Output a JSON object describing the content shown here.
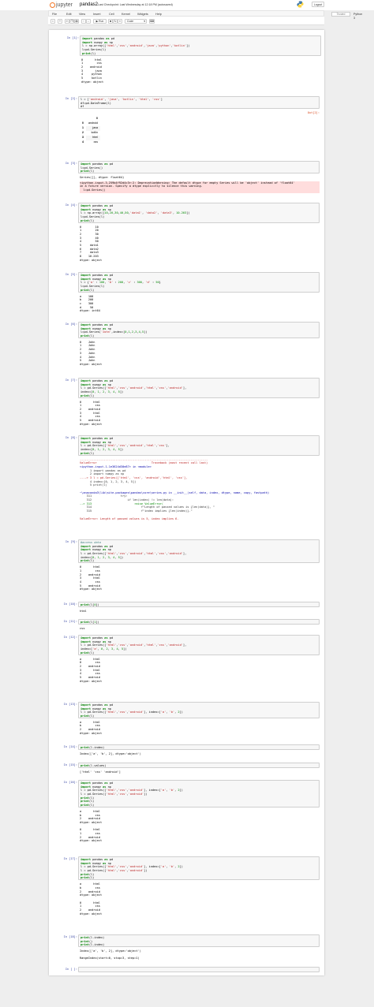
{
  "header": {
    "brand": "jupyter",
    "notebook_name": "pandas2",
    "checkpoint": "Last Checkpoint: Last Wednesday at 12:18 PM",
    "autosave": "(autosaved)",
    "logout": "Logout"
  },
  "menu": {
    "items": [
      "File",
      "Edit",
      "View",
      "Insert",
      "Cell",
      "Kernel",
      "Widgets",
      "Help"
    ],
    "trusted": "Trusted",
    "kernel": "Python 3"
  },
  "toolbar": {
    "run": "Run",
    "celltype": "Code"
  },
  "cells": [
    {
      "prompt": "In [1]:",
      "code": [
        "import pandas as pd",
        "import numpy as np",
        "l = np.array(['html','css','android','java','python','kotlin'])",
        "l=pd.Series(l)",
        "print(l)"
      ],
      "output": [
        "0       html",
        "1        css",
        "2    android",
        "3       java",
        "4     python",
        "5     kotlin",
        "dtype: object"
      ]
    },
    {
      "prompt": "In [2]:",
      "code": [
        "l = ['android', 'java', 'kotlin', 'html', 'css']",
        "df=pd.DataFrame(l)",
        "df"
      ],
      "out_prompt": "Out[2]:",
      "table": {
        "header": [
          "",
          "0"
        ],
        "rows": [
          [
            "0",
            "android"
          ],
          [
            "1",
            "java"
          ],
          [
            "2",
            "kotlin"
          ],
          [
            "3",
            "html"
          ],
          [
            "4",
            "css"
          ]
        ]
      }
    },
    {
      "prompt": "In [3]:",
      "code": [
        "import pandas as pd",
        "l=pd.Series()",
        "print(l)"
      ],
      "output": [
        "Series([], dtype: float64)"
      ],
      "stderr": [
        "<ipython-input-3-259b4f92d4c3>:2: DeprecationWarning: The default dtype for empty Series will be 'object' instead of 'float64'",
        "in a future version. Specify a dtype explicitly to silence this warning.",
        "  l=pd.Series()"
      ]
    },
    {
      "prompt": "In [4]:",
      "code": [
        "import pandas as pd",
        "import numpy as np",
        "l = np.array([10,20,30,40,50,'data1', 'data2', 'data3', 10.203])",
        "l=pd.Series(l)",
        "print(l)"
      ],
      "output": [
        "0        10",
        "1        20",
        "2        30",
        "3        40",
        "4        50",
        "5     data1",
        "6     data2",
        "7     data3",
        "8    10.203",
        "dtype: object"
      ]
    },
    {
      "prompt": "In [5]:",
      "code": [
        "import pandas as pd",
        "import numpy as np",
        "l = {'a' : 100, 'b' : 200, 'c' : 300, 'd' : 50}",
        "l=pd.Series(l)",
        "print(l)"
      ],
      "output": [
        "a    100",
        "b    200",
        "c    300",
        "d     50",
        "dtype: int64"
      ]
    },
    {
      "prompt": "In [6]:",
      "code": [
        "import pandas as pd",
        "import numpy as np",
        "l=pd.Series('John',index=[0,1,2,3,4,5])",
        "print(l)"
      ],
      "output": [
        "0    John",
        "1    John",
        "2    John",
        "3    John",
        "4    John",
        "5    John",
        "dtype: object"
      ]
    },
    {
      "prompt": "In [7]:",
      "code": [
        "import pandas as pd",
        "import numpy as np",
        "l = pd.Series(['html','css','android','html','css','android'],",
        "index=[0, 1, 2, 3, 4, 5])",
        "print(l)"
      ],
      "output": [
        "0       html",
        "1        css",
        "2    android",
        "3       html",
        "4        css",
        "5    android",
        "dtype: object"
      ]
    },
    {
      "prompt": "In [8]:",
      "code": [
        "import pandas as pd",
        "import numpy as np",
        "l = pd.Series(['html','css','android','html','css'],",
        "index=[0, 1, 2, 3, 4, 5])",
        "print(l)"
      ],
      "error": [
        "---------------------------------------------------------------------------",
        "ValueError                                Traceback (most recent call last)",
        "<ipython-input-1-1e3624d30e87> in <module>",
        "      1 import pandas as pd",
        "      2 import numpy as np",
        "----> 3 l = pd.Series(['html', 'css', 'android','html', 'css'],",
        "      4 index=[0, 1, 2, 3, 4, 5])",
        "      5 print(l)",
        "",
        "~\\anaconda3\\lib\\site-packages\\pandas\\core\\series.py in __init__(self, data, index, dtype, name, copy, fastpath)",
        "    311                 try:",
        "    312                     if len(index) != len(data):",
        "--> 313                         raise ValueError(",
        "    314                             f\"Length of passed values is {len(data)}, \"",
        "    315                             f\"index implies {len(index)}.\"",
        "",
        "ValueError: Length of passed values is 5, index implies 6."
      ]
    },
    {
      "prompt": "In [9]:",
      "code": [
        "#access data",
        "import pandas as pd",
        "import numpy as np",
        "l = pd.Series(['html','css','android','html','css','android'],",
        "index=[0, 1, 2, 3, 4, 5])",
        "print(l)"
      ],
      "output": [
        "0       html",
        "1        css",
        "2    android",
        "3       html",
        "4        css",
        "5    android",
        "dtype: object"
      ]
    },
    {
      "prompt": "In [10]:",
      "code": [
        "print(l[0])"
      ],
      "output": [
        "html"
      ]
    },
    {
      "prompt": "In [11]:",
      "code": [
        "print(l[1])"
      ],
      "output": [
        "css"
      ]
    },
    {
      "prompt": "In [12]:",
      "code": [
        "import pandas as pd",
        "import numpy as np",
        "l = pd.Series(['html','css','android','html','css','android'],",
        "index=['a', 0, 2, 3, 4, 5])",
        "print(l)"
      ],
      "output": [
        "a       html",
        "0        css",
        "2    android",
        "3       html",
        "4        css",
        "5    android",
        "dtype: object"
      ]
    },
    {
      "prompt": "In [13]:",
      "code": [
        "import pandas as pd",
        "import numpy as np",
        "l = pd.Series(['html','css','android'], index=['a', 'b', 2])",
        "print(l)"
      ],
      "output": [
        "a       html",
        "b        css",
        "2    android",
        "dtype: object"
      ]
    },
    {
      "prompt": "In [14]:",
      "code": [
        "print(l.index)"
      ],
      "output": [
        "Index(['a', 'b', 2], dtype='object')"
      ]
    },
    {
      "prompt": "In [15]:",
      "code": [
        "print(l.values)"
      ],
      "output": [
        "['html' 'css' 'android']"
      ]
    },
    {
      "prompt": "In [16]:",
      "code": [
        "import pandas as pd",
        "import numpy as np",
        "l = pd.Series(['html','css','android'], index=['a', 'b', 2])",
        "l = pd.Series(['html','css','android'])",
        "print(l)",
        "print(l)",
        "print(l)"
      ],
      "output": [
        "a       html",
        "b        css",
        "2    android",
        "dtype: object",
        "",
        "0       html",
        "1        css",
        "2    android",
        "dtype: object"
      ]
    },
    {
      "prompt": "In [17]:",
      "code": [
        "import pandas as pd",
        "import numpy as np",
        "l = pd.Series(['html','css','android'], index=['a', 'b', 2])",
        "l = pd.Series(['html','css','android'])",
        "print(l)",
        "print(l)"
      ],
      "output": [
        "a       html",
        "b        css",
        "2    android",
        "dtype: object",
        "",
        "0       html",
        "1        css",
        "2    android",
        "dtype: object"
      ]
    },
    {
      "prompt": "In [18]:",
      "code": [
        "print(l.index)",
        "print()",
        "print(l.index)"
      ],
      "output": [
        "Index(['a', 'b', 2], dtype='object')",
        "",
        "RangeIndex(start=0, stop=3, step=1)"
      ]
    },
    {
      "prompt": "In [ ]:",
      "code": [
        ""
      ]
    }
  ]
}
